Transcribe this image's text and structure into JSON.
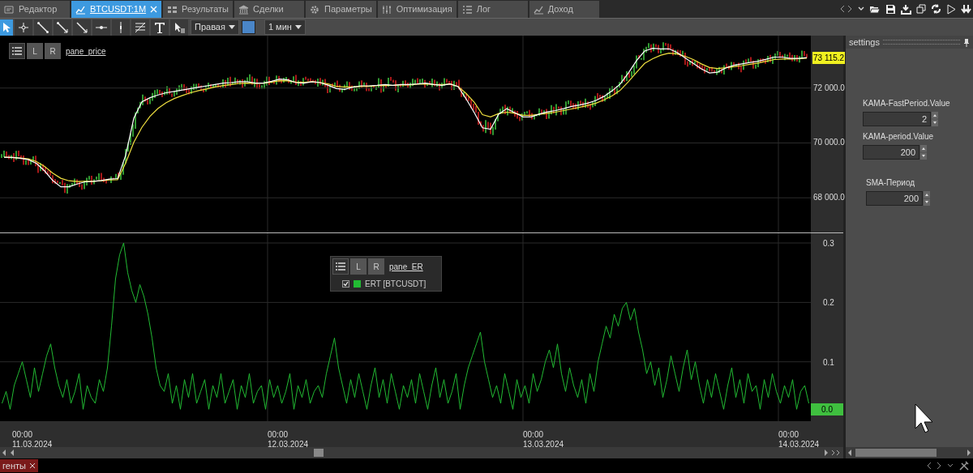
{
  "tabs": [
    {
      "label": "Редактор",
      "selected": false
    },
    {
      "label": "BTCUSDT:1M",
      "selected": true
    },
    {
      "label": "Результаты",
      "selected": false
    },
    {
      "label": "Сделки",
      "selected": false
    },
    {
      "label": "Параметры",
      "selected": false
    },
    {
      "label": "Оптимизация",
      "selected": false
    },
    {
      "label": "Лог",
      "selected": false
    },
    {
      "label": "Доход",
      "selected": false
    }
  ],
  "toolbar": {
    "anchor_dropdown": "Правая",
    "timeframe_dropdown": "1 мин"
  },
  "price_pane": {
    "name": "pane_price",
    "buttons": [
      "L",
      "R"
    ],
    "last_price": "73 115.2",
    "chart_data": {
      "type": "line",
      "grid": true,
      "ylim": [
        66735,
        73912
      ],
      "yticks": [
        {
          "value": 72000,
          "label": "72 000.0"
        },
        {
          "value": 70000,
          "label": "70 000.0"
        },
        {
          "value": 68000,
          "label": "68 000.0"
        }
      ],
      "series": [
        {
          "color": "#f0e040",
          "values": [
            69480,
            69470,
            69450,
            69420,
            69320,
            69140,
            68900,
            68710,
            68620,
            68590,
            68600,
            68600,
            68620,
            68650,
            68660,
            69270,
            70020,
            70570,
            70970,
            71260,
            71470,
            71620,
            71730,
            71830,
            71910,
            71970,
            72040,
            72090,
            72130,
            72170,
            72180,
            72170,
            72180,
            72220,
            72270,
            72260,
            72220,
            72210,
            72230,
            72200,
            72150,
            72060,
            72040,
            72040,
            72060,
            72060,
            72090,
            72090,
            72100,
            72120,
            72110,
            72140,
            72150,
            72130,
            72120,
            72150,
            72060,
            71800,
            71480,
            71030,
            70950,
            71070,
            71120,
            71080,
            71010,
            71010,
            71040,
            71080,
            71120,
            71180,
            71240,
            71300,
            71370,
            71450,
            71570,
            71720,
            71920,
            72230,
            72570,
            72900,
            73070,
            73200,
            73270,
            73250,
            73160,
            73040,
            72880,
            72750,
            72710,
            72740,
            72780,
            72820,
            72870,
            72910,
            72980,
            73040,
            73060,
            73060,
            73070,
            73090
          ]
        },
        {
          "color": "#ffffff",
          "values": [
            69480,
            69470,
            69440,
            69390,
            69250,
            68980,
            68630,
            68400,
            68400,
            68500,
            68580,
            68600,
            68630,
            68680,
            68700,
            69550,
            70900,
            71500,
            71650,
            71750,
            71830,
            71880,
            71930,
            71980,
            72030,
            72080,
            72130,
            72180,
            72200,
            72230,
            72230,
            72180,
            72180,
            72250,
            72330,
            72300,
            72200,
            72180,
            72230,
            72200,
            72100,
            71980,
            71950,
            72030,
            72080,
            72080,
            72100,
            72130,
            72100,
            72130,
            72130,
            72150,
            72180,
            72130,
            72100,
            72150,
            72050,
            71600,
            71100,
            70550,
            70500,
            71050,
            71250,
            71100,
            70950,
            70950,
            71050,
            71130,
            71180,
            71250,
            71330,
            71380,
            71450,
            71550,
            71700,
            71900,
            72150,
            72550,
            73000,
            73350,
            73450,
            73430,
            73430,
            73300,
            73100,
            72900,
            72700,
            72550,
            72580,
            72730,
            72830,
            72880,
            72930,
            72980,
            73050,
            73130,
            73130,
            73080,
            73080,
            73110
          ]
        }
      ]
    }
  },
  "er_pane": {
    "name": "pane_ER",
    "buttons": [
      "L",
      "R"
    ],
    "legend": {
      "checked": true
    },
    "last_value": "0.0",
    "chart_data": {
      "type": "line",
      "grid": true,
      "ylim": [
        0,
        0.3164
      ],
      "yticks": [
        0.3,
        0.2,
        0.1
      ],
      "series": [
        {
          "name": "ERT [BTCUSDT]",
          "color": "#22bb33",
          "values": [
            0.03,
            0.05,
            0.02,
            0.06,
            0.08,
            0.1,
            0.07,
            0.04,
            0.09,
            0.05,
            0.08,
            0.11,
            0.13,
            0.09,
            0.06,
            0.04,
            0.07,
            0.03,
            0.05,
            0.08,
            0.02,
            0.06,
            0.04,
            0.03,
            0.07,
            0.05,
            0.09,
            0.16,
            0.24,
            0.28,
            0.3,
            0.25,
            0.22,
            0.2,
            0.23,
            0.21,
            0.18,
            0.14,
            0.09,
            0.06,
            0.05,
            0.08,
            0.03,
            0.06,
            0.02,
            0.07,
            0.04,
            0.08,
            0.03,
            0.05,
            0.07,
            0.02,
            0.06,
            0.04,
            0.08,
            0.03,
            0.05,
            0.07,
            0.02,
            0.06,
            0.04,
            0.08,
            0.03,
            0.05,
            0.06,
            0.02,
            0.07,
            0.04,
            0.06,
            0.03,
            0.05,
            0.08,
            0.02,
            0.06,
            0.04,
            0.07,
            0.03,
            0.05,
            0.06,
            0.04,
            0.08,
            0.11,
            0.14,
            0.09,
            0.06,
            0.03,
            0.07,
            0.04,
            0.08,
            0.05,
            0.02,
            0.06,
            0.09,
            0.04,
            0.07,
            0.03,
            0.08,
            0.05,
            0.02,
            0.06,
            0.04,
            0.07,
            0.03,
            0.08,
            0.05,
            0.02,
            0.06,
            0.09,
            0.04,
            0.07,
            0.03,
            0.05,
            0.08,
            0.02,
            0.06,
            0.09,
            0.11,
            0.13,
            0.15,
            0.1,
            0.07,
            0.04,
            0.06,
            0.03,
            0.08,
            0.05,
            0.02,
            0.07,
            0.04,
            0.06,
            0.03,
            0.08,
            0.05,
            0.07,
            0.1,
            0.12,
            0.09,
            0.13,
            0.08,
            0.05,
            0.09,
            0.06,
            0.04,
            0.07,
            0.03,
            0.08,
            0.05,
            0.1,
            0.13,
            0.16,
            0.14,
            0.18,
            0.16,
            0.19,
            0.2,
            0.17,
            0.19,
            0.15,
            0.12,
            0.08,
            0.1,
            0.06,
            0.09,
            0.04,
            0.07,
            0.11,
            0.08,
            0.05,
            0.09,
            0.12,
            0.07,
            0.1,
            0.06,
            0.03,
            0.07,
            0.04,
            0.08,
            0.05,
            0.02,
            0.06,
            0.09,
            0.04,
            0.07,
            0.03,
            0.08,
            0.05,
            0.06,
            0.02,
            0.07,
            0.04,
            0.08,
            0.05,
            0.03,
            0.06,
            0.04,
            0.07,
            0.02,
            0.05,
            0.06,
            0.03
          ]
        }
      ]
    }
  },
  "time_axis": [
    {
      "time": "00:00",
      "date": "11.03.2024"
    },
    {
      "time": "00:00",
      "date": "12.03.2024"
    },
    {
      "time": "00:00",
      "date": "13.03.2024"
    },
    {
      "time": "00:00",
      "date": "14.03.2024"
    }
  ],
  "settings": {
    "title": "settings",
    "fields": [
      {
        "label": "KAMA-FastPeriod.Value",
        "value": "2"
      },
      {
        "label": "KAMA-period.Value",
        "value": "200"
      },
      {
        "label": "SMA-Период",
        "value": "200"
      }
    ]
  },
  "bottom_tab": "генты"
}
